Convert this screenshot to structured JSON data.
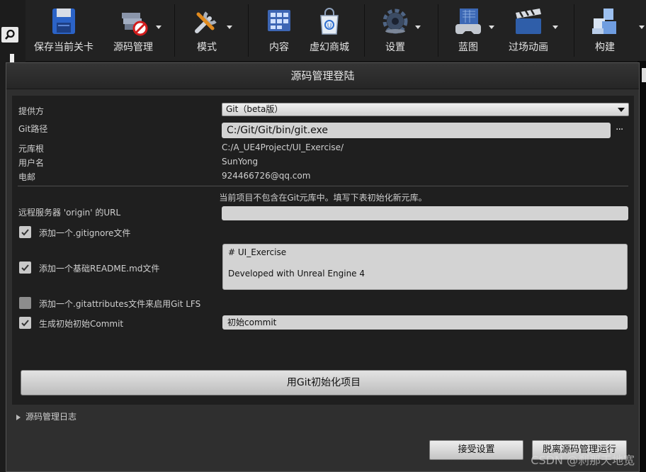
{
  "toolbar": {
    "items": [
      {
        "label": "保存当前关卡",
        "icon": "save-icon"
      },
      {
        "label": "源码管理",
        "icon": "source-control-icon"
      },
      {
        "label": "模式",
        "icon": "modes-icon"
      },
      {
        "label": "内容",
        "icon": "content-icon"
      },
      {
        "label": "虚幻商城",
        "icon": "marketplace-icon"
      },
      {
        "label": "设置",
        "icon": "settings-icon"
      },
      {
        "label": "蓝图",
        "icon": "blueprint-icon"
      },
      {
        "label": "过场动画",
        "icon": "cinematics-icon"
      },
      {
        "label": "构建",
        "icon": "build-icon"
      }
    ]
  },
  "dialog": {
    "title": "源码管理登陆",
    "provider": {
      "label": "提供方",
      "value": "Git（beta版）"
    },
    "git_path": {
      "label": "Git路径",
      "value": "C:/Git/Git/bin/git.exe",
      "browse": "···"
    },
    "repo_root": {
      "label": "元库根",
      "value": "C:/A_UE4Project/UI_Exercise/"
    },
    "user_name": {
      "label": "用户名",
      "value": "SunYong"
    },
    "email": {
      "label": "电邮",
      "value": "924466726@qq.com"
    },
    "info_text": "当前项目不包含在Git元库中。填写下表初始化新元库。",
    "remote_url": {
      "label": "远程服务器 'origin' 的URL",
      "value": ""
    },
    "options": {
      "gitignore": {
        "label": "添加一个.gitignore文件",
        "checked": true
      },
      "readme": {
        "label": "添加一个基础README.md文件",
        "checked": true,
        "content_line1": "# UI_Exercise",
        "content_line2": "Developed with Unreal Engine 4"
      },
      "gitattributes": {
        "label": "添加一个.gitattributes文件来启用Git LFS",
        "checked": false
      },
      "commit": {
        "label": "生成初始初始Commit",
        "checked": true,
        "message": "初始commit"
      }
    },
    "init_button": "用Git初始化项目",
    "log_label": "源码管理日志",
    "accept_button": "接受设置",
    "disconnect_button": "脱离源码管理运行"
  },
  "watermark": "CSDN @刹那天地宽",
  "colors": {
    "dialog_bg": "#2f2f2f",
    "panel_bg": "#1f1f1f",
    "toolbar_bg": "#222222"
  }
}
